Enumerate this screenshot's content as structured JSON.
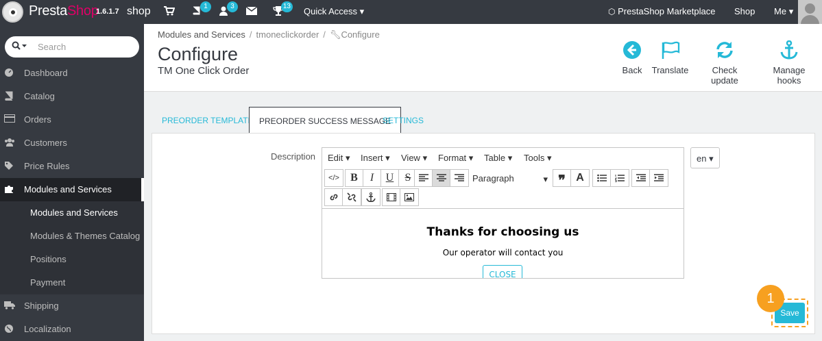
{
  "topbar": {
    "logo_presta": "Presta",
    "logo_shop": "Shop",
    "version": "1.6.1.7",
    "shop_name": "shop",
    "badges": {
      "orders": "1",
      "customers": "3",
      "messages": "13"
    },
    "quick_access": "Quick Access",
    "marketplace": "PrestaShop Marketplace",
    "shop_link": "Shop",
    "me": "Me"
  },
  "sidebar": {
    "search_placeholder": "Search",
    "items": [
      {
        "label": "Dashboard"
      },
      {
        "label": "Catalog"
      },
      {
        "label": "Orders"
      },
      {
        "label": "Customers"
      },
      {
        "label": "Price Rules"
      },
      {
        "label": "Modules and Services"
      },
      {
        "label": "Shipping"
      },
      {
        "label": "Localization"
      }
    ],
    "subitems": [
      {
        "label": "Modules and Services"
      },
      {
        "label": "Modules & Themes Catalog"
      },
      {
        "label": "Positions"
      },
      {
        "label": "Payment"
      }
    ]
  },
  "header": {
    "breadcrumb": [
      "Modules and Services",
      "tmoneclickorder",
      "Configure"
    ],
    "title": "Configure",
    "subtitle": "TM One Click Order",
    "toolbar": {
      "back": "Back",
      "translate": "Translate",
      "check_update": "Check update",
      "manage_hooks": "Manage hooks"
    }
  },
  "tabs": [
    {
      "label": "PREORDER TEMPLATE"
    },
    {
      "label": "PREORDER SUCCESS MESSAGE"
    },
    {
      "label": "SETTINGS"
    }
  ],
  "form": {
    "description_label": "Description",
    "language": "en",
    "save": "Save",
    "step_number": "1"
  },
  "editor": {
    "menus": [
      "Edit",
      "Insert",
      "View",
      "Format",
      "Table",
      "Tools"
    ],
    "format_select": "Paragraph",
    "content": {
      "heading": "Thanks for choosing us",
      "text": "Our operator will contact you",
      "button": "CLOSE"
    }
  },
  "colors": {
    "accent": "#25b9d7",
    "dark": "#363a41",
    "highlight": "#f7a020"
  }
}
